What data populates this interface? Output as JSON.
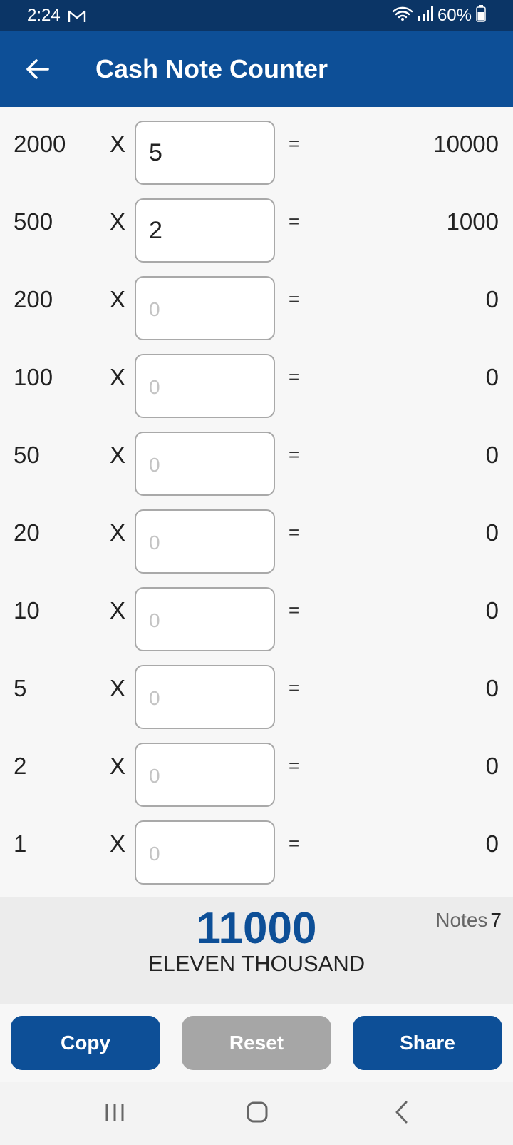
{
  "status_bar": {
    "time": "2:24",
    "battery": "60%",
    "icons": [
      "gmail-icon",
      "wifi-icon",
      "signal-icon",
      "battery-icon"
    ]
  },
  "app_bar": {
    "title": "Cash Note Counter",
    "back_icon": "back-arrow-icon"
  },
  "operators": {
    "times": "X",
    "equals": "="
  },
  "rows": [
    {
      "denomination": "2000",
      "quantity": "5",
      "placeholder": "0",
      "amount": "10000"
    },
    {
      "denomination": "500",
      "quantity": "2",
      "placeholder": "0",
      "amount": "1000"
    },
    {
      "denomination": "200",
      "quantity": "",
      "placeholder": "0",
      "amount": "0"
    },
    {
      "denomination": "100",
      "quantity": "",
      "placeholder": "0",
      "amount": "0"
    },
    {
      "denomination": "50",
      "quantity": "",
      "placeholder": "0",
      "amount": "0"
    },
    {
      "denomination": "20",
      "quantity": "",
      "placeholder": "0",
      "amount": "0"
    },
    {
      "denomination": "10",
      "quantity": "",
      "placeholder": "0",
      "amount": "0"
    },
    {
      "denomination": "5",
      "quantity": "",
      "placeholder": "0",
      "amount": "0"
    },
    {
      "denomination": "2",
      "quantity": "",
      "placeholder": "0",
      "amount": "0"
    },
    {
      "denomination": "1",
      "quantity": "",
      "placeholder": "0",
      "amount": "0"
    }
  ],
  "summary": {
    "total": "11000",
    "total_words": "ELEVEN THOUSAND",
    "notes_label": "Notes",
    "notes_count": "7"
  },
  "actions": {
    "copy_label": "Copy",
    "reset_label": "Reset",
    "share_label": "Share"
  },
  "nav_bar": {
    "icons": [
      "recent-apps-icon",
      "home-icon",
      "back-icon"
    ]
  },
  "colors": {
    "primary": "#0d4f97",
    "status_bar": "#0b3566",
    "reset_button": "#a6a6a6"
  }
}
